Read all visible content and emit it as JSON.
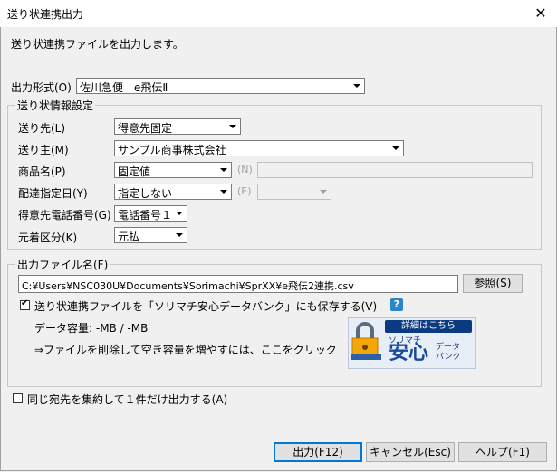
{
  "window": {
    "title": "送り状連携出力",
    "close_glyph": "✕"
  },
  "intro": "送り状連携ファイルを出力します。",
  "output_format": {
    "label": "出力形式(O)",
    "value": "佐川急便　e飛伝Ⅱ"
  },
  "settings_group": {
    "legend": "送り状情報設定",
    "destination": {
      "label": "送り先(L)",
      "value": "得意先固定"
    },
    "sender": {
      "label": "送り主(M)",
      "value": "サンプル商事株式会社"
    },
    "product_name": {
      "label": "商品名(P)",
      "value": "固定値",
      "extra_label": "(N)"
    },
    "delivery_date": {
      "label": "配達指定日(Y)",
      "value": "指定しない",
      "extra_label": "(E)"
    },
    "phone": {
      "label": "得意先電話番号(G)",
      "value": "電話番号１"
    },
    "charge": {
      "label": "元着区分(K)",
      "value": "元払"
    }
  },
  "file_group": {
    "legend": "出力ファイル名(F)",
    "path": "C:¥Users¥NSC030U¥Documents¥Sorimachi¥SprXX¥e飛伝2連携.csv",
    "browse_label": "参照(S)",
    "save_checkbox_label": "送り状連携ファイルを「ソリマチ安心データバンク」にも保存する(V)",
    "save_checked": true,
    "help_glyph": "?",
    "capacity": "データ容量: -MB / -MB",
    "hint": "⇒ファイルを削除して空き容量を増やすには、ここをクリック",
    "banner": {
      "top": "詳細はこちら",
      "brand_small": "ソリマチ",
      "brand_big": "安心",
      "brand_right": "データ\nバンク"
    }
  },
  "merge_checkbox": {
    "label": "同じ宛先を集約して１件だけ出力する(A)",
    "checked": false
  },
  "buttons": {
    "output": "出力(F12)",
    "cancel": "キャンセル(Esc)",
    "help": "ヘルプ(F1)"
  }
}
